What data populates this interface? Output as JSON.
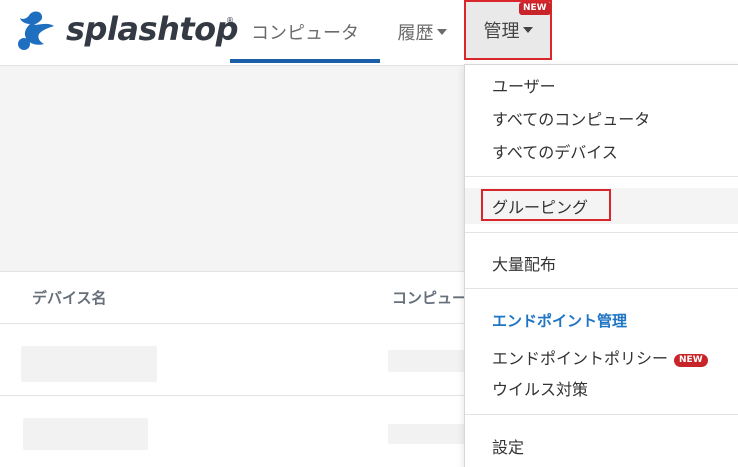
{
  "header": {
    "logo_text": "splashtop",
    "logo_mark": "®",
    "nav": {
      "computers": "コンピュータ",
      "history": "履歴",
      "manage": "管理",
      "manage_badge": "NEW"
    }
  },
  "table": {
    "columns": {
      "device_name": "デバイス名",
      "computer": "コンピュータ"
    }
  },
  "dropdown": {
    "users": "ユーザー",
    "all_computers": "すべてのコンピュータ",
    "all_devices": "すべてのデバイス",
    "grouping": "グルーピング",
    "mass_deploy": "大量配布",
    "endpoint_section": "エンドポイント管理",
    "endpoint_policy": "エンドポイントポリシー",
    "endpoint_policy_badge": "NEW",
    "antivirus": "ウイルス対策",
    "settings": "設定"
  },
  "colors": {
    "accent_blue": "#1a5fa8",
    "section_blue": "#1f75c4",
    "highlight_red": "#d9262c",
    "badge_red": "#c8252b",
    "logo_blue": "#1e6fc0"
  }
}
